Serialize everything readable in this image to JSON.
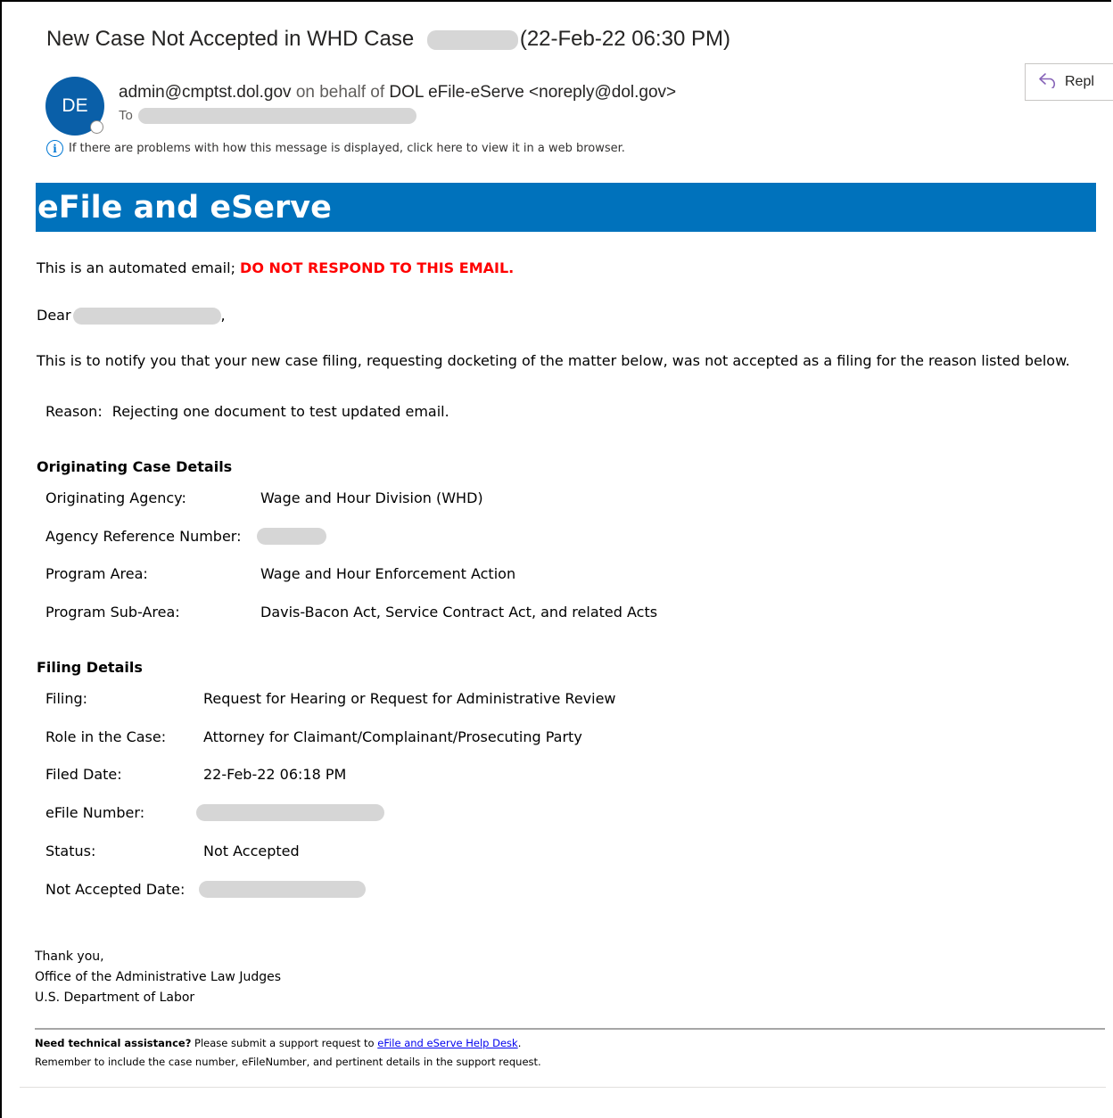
{
  "header": {
    "subject_prefix": "New Case Not Accepted in WHD Case",
    "subject_suffix": "(22-Feb-22 06:30 PM)",
    "avatar_initials": "DE",
    "sender_email": "admin@cmptst.dol.gov",
    "on_behalf_text": "on behalf of",
    "sender_name": "DOL eFile-eServe <noreply@dol.gov>",
    "to_label": "To",
    "reply_label": "Repl",
    "info_text": "If there are problems with how this message is displayed, click here to view it in a web browser."
  },
  "banner": {
    "title": "eFile and eServe"
  },
  "body": {
    "automated_intro": "This is an automated email;",
    "warning": "DO NOT RESPOND TO THIS EMAIL.",
    "dear": "Dear",
    "dear_comma": ",",
    "notification": "This is to notify you that your new case filing, requesting docketing of the matter below, was not accepted as a filing for the reason listed below.",
    "reason_label": "Reason:",
    "reason_value": "Rejecting one document to test updated email."
  },
  "originating_case": {
    "title": "Originating Case Details",
    "rows": [
      {
        "label": "Originating Agency:",
        "value": "Wage and Hour Division (WHD)"
      },
      {
        "label": "Agency Reference Number:",
        "value": ""
      },
      {
        "label": "Program Area:",
        "value": "Wage and Hour Enforcement Action"
      },
      {
        "label": "Program Sub-Area:",
        "value": "Davis-Bacon Act, Service Contract Act, and related Acts"
      }
    ]
  },
  "filing": {
    "title": "Filing Details",
    "rows": [
      {
        "label": "Filing:",
        "value": "Request for Hearing or Request for Administrative Review"
      },
      {
        "label": "Role in the Case:",
        "value": "Attorney for Claimant/Complainant/Prosecuting Party"
      },
      {
        "label": "Filed Date:",
        "value": "22-Feb-22 06:18 PM"
      },
      {
        "label": "eFile Number:",
        "value": ""
      },
      {
        "label": "Status:",
        "value": "Not Accepted"
      },
      {
        "label": "Not Accepted Date:",
        "value": ""
      }
    ]
  },
  "signature": {
    "thanks": "Thank you,",
    "office": "Office of the Administrative Law Judges",
    "department": "U.S. Department of Labor"
  },
  "footer": {
    "help_bold": "Need technical assistance?",
    "help_text": "Please submit a support request to",
    "help_link": "eFile and eServe Help Desk",
    "help_period": ".",
    "reminder": "Remember to include the case number, eFileNumber, and pertinent details in the support request."
  },
  "colors": {
    "banner": "#0072bc",
    "avatar": "#0a5fa8",
    "warning": "#ff0000",
    "link": "#0000ee",
    "info_icon": "#0078d4"
  },
  "icons": [
    "info-icon",
    "reply-arrow-icon",
    "presence-status-icon"
  ]
}
